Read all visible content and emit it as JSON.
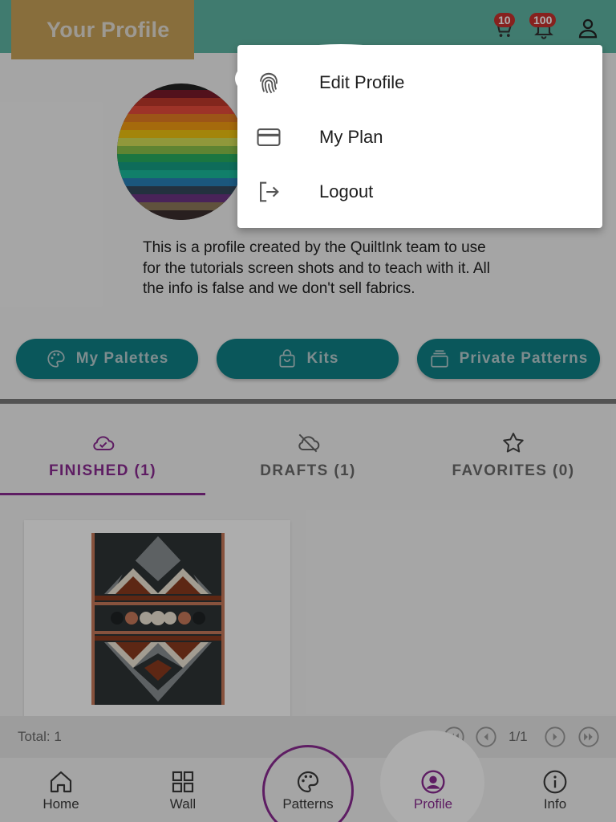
{
  "header": {
    "title": "Your Profile",
    "cart_badge": "10",
    "notifications_badge": "100"
  },
  "profile": {
    "bio": "This is a profile created by the QuiltInk team to use for the tutorials screen shots and to teach with it. All the info is false and we don't sell fabrics."
  },
  "actions": {
    "my_palettes": "My Palettes",
    "kits": "Kits",
    "private_patterns": "Private Patterns"
  },
  "tabs": [
    {
      "label": "FINISHED (1)",
      "active": true
    },
    {
      "label": "DRAFTS (1)",
      "active": false
    },
    {
      "label": "FAVORITES (0)",
      "active": false
    }
  ],
  "pagination": {
    "total": "Total: 1",
    "page": "1/1"
  },
  "bottom_nav": [
    {
      "label": "Home"
    },
    {
      "label": "Wall"
    },
    {
      "label": "Patterns"
    },
    {
      "label": "Profile",
      "active": true
    },
    {
      "label": "Info"
    }
  ],
  "menu": {
    "items": [
      {
        "label": "Edit Profile",
        "icon": "fingerprint-icon"
      },
      {
        "label": "My Plan",
        "icon": "credit-card-icon"
      },
      {
        "label": "Logout",
        "icon": "logout-icon"
      }
    ]
  },
  "colors": {
    "topbar": "#5fb5a4",
    "accent": "#8b2c93",
    "teal_button": "#0f8186",
    "badge": "#c8322d"
  }
}
